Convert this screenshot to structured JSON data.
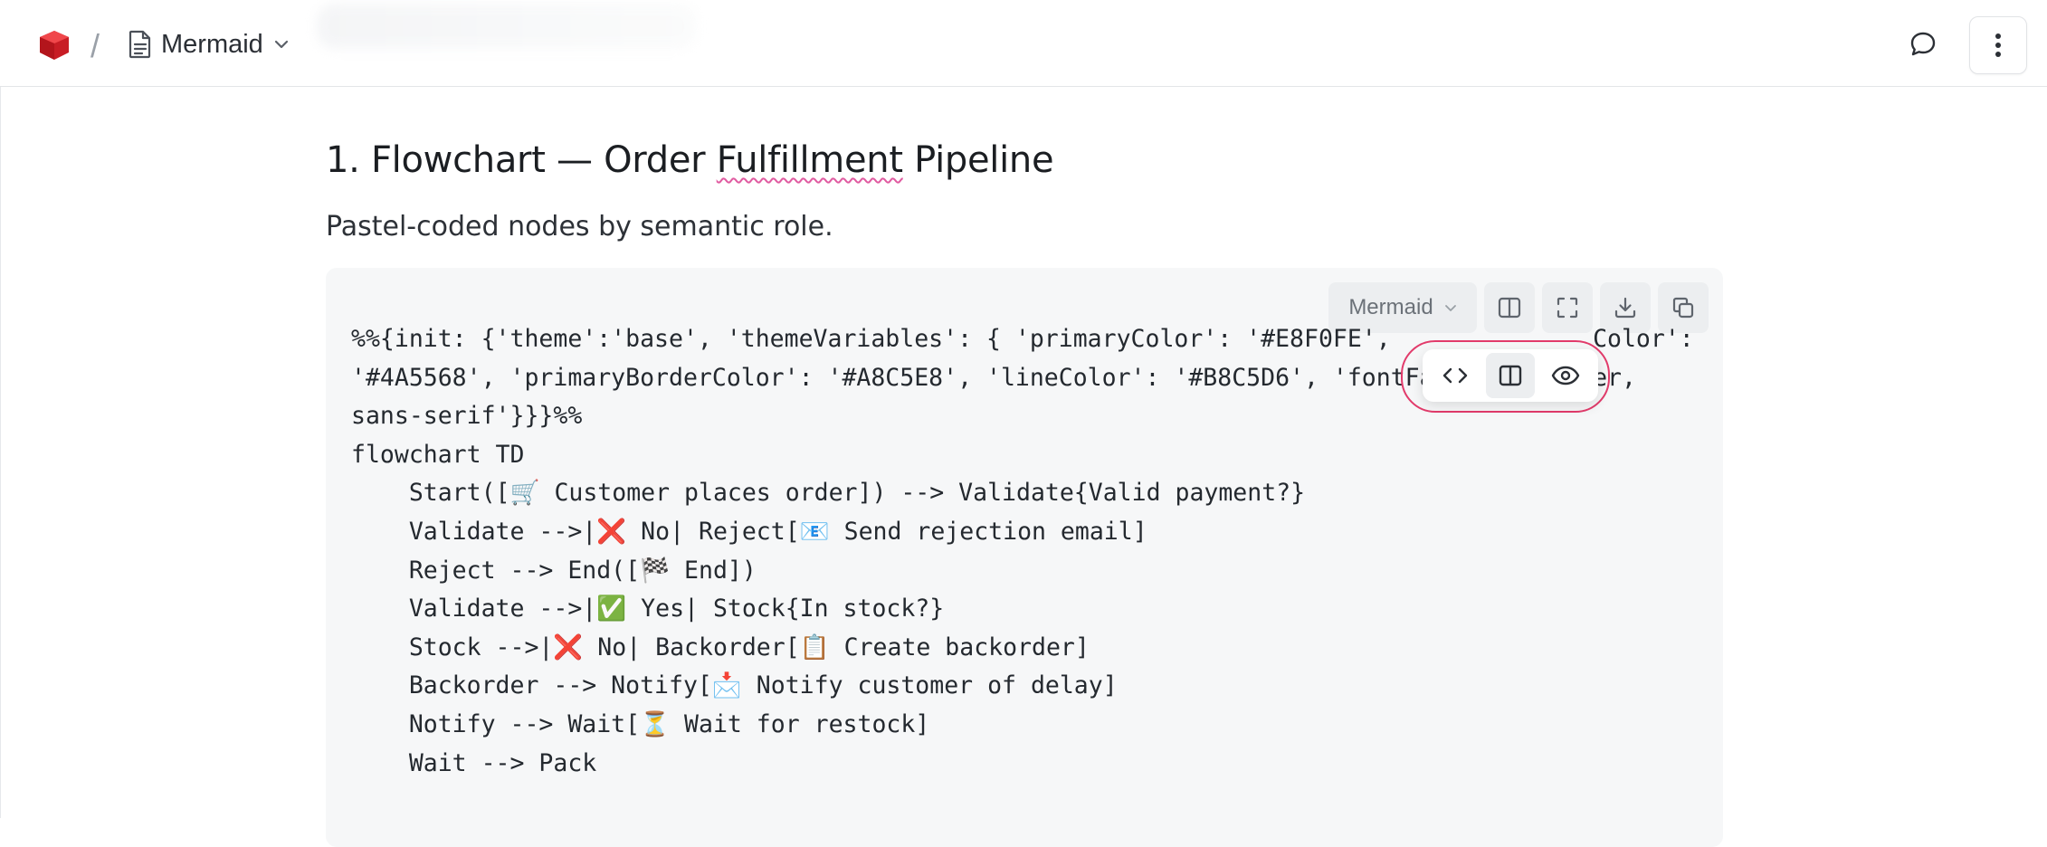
{
  "header": {
    "doc_title": "Mermaid",
    "separator": "/"
  },
  "content": {
    "heading_prefix": "1. Flowchart — Order ",
    "heading_misspelled": "Fulfillment",
    "heading_suffix": " Pipeline",
    "subtitle": "Pastel-coded nodes by semantic role."
  },
  "code_block": {
    "language": "Mermaid",
    "lines": [
      "%%{init: {'theme':'base', 'themeVariables': { 'primaryColor': '#E8F0FE',              Color':",
      "'#4A5568', 'primaryBorderColor': '#A8C5E8', 'lineColor': '#B8C5D6', 'fontFamily': 'Inter,",
      "sans-serif'}}}%%",
      "flowchart TD",
      "    Start([🛒 Customer places order]) --> Validate{Valid payment?}",
      "    Validate -->|❌ No| Reject[📧 Send rejection email]",
      "    Reject --> End([🏁 End])",
      "    Validate -->|✅ Yes| Stock{In stock?}",
      "    Stock -->|❌ No| Backorder[📋 Create backorder]",
      "    Backorder --> Notify[📩 Notify customer of delay]",
      "    Notify --> Wait[⏳ Wait for restock]",
      "    Wait --> Pack"
    ]
  },
  "icons": {
    "logo": "app-logo",
    "doc": "document-icon",
    "chevron": "chevron-down-icon",
    "comment": "comment-icon",
    "more": "more-vertical-icon",
    "split": "split-view-icon",
    "fullscreen": "fullscreen-icon",
    "download": "download-icon",
    "copy": "copy-icon",
    "code": "code-icon",
    "preview": "eye-icon"
  },
  "colors": {
    "accent_ring": "#e23b6b",
    "logo_red": "#e0282f"
  }
}
